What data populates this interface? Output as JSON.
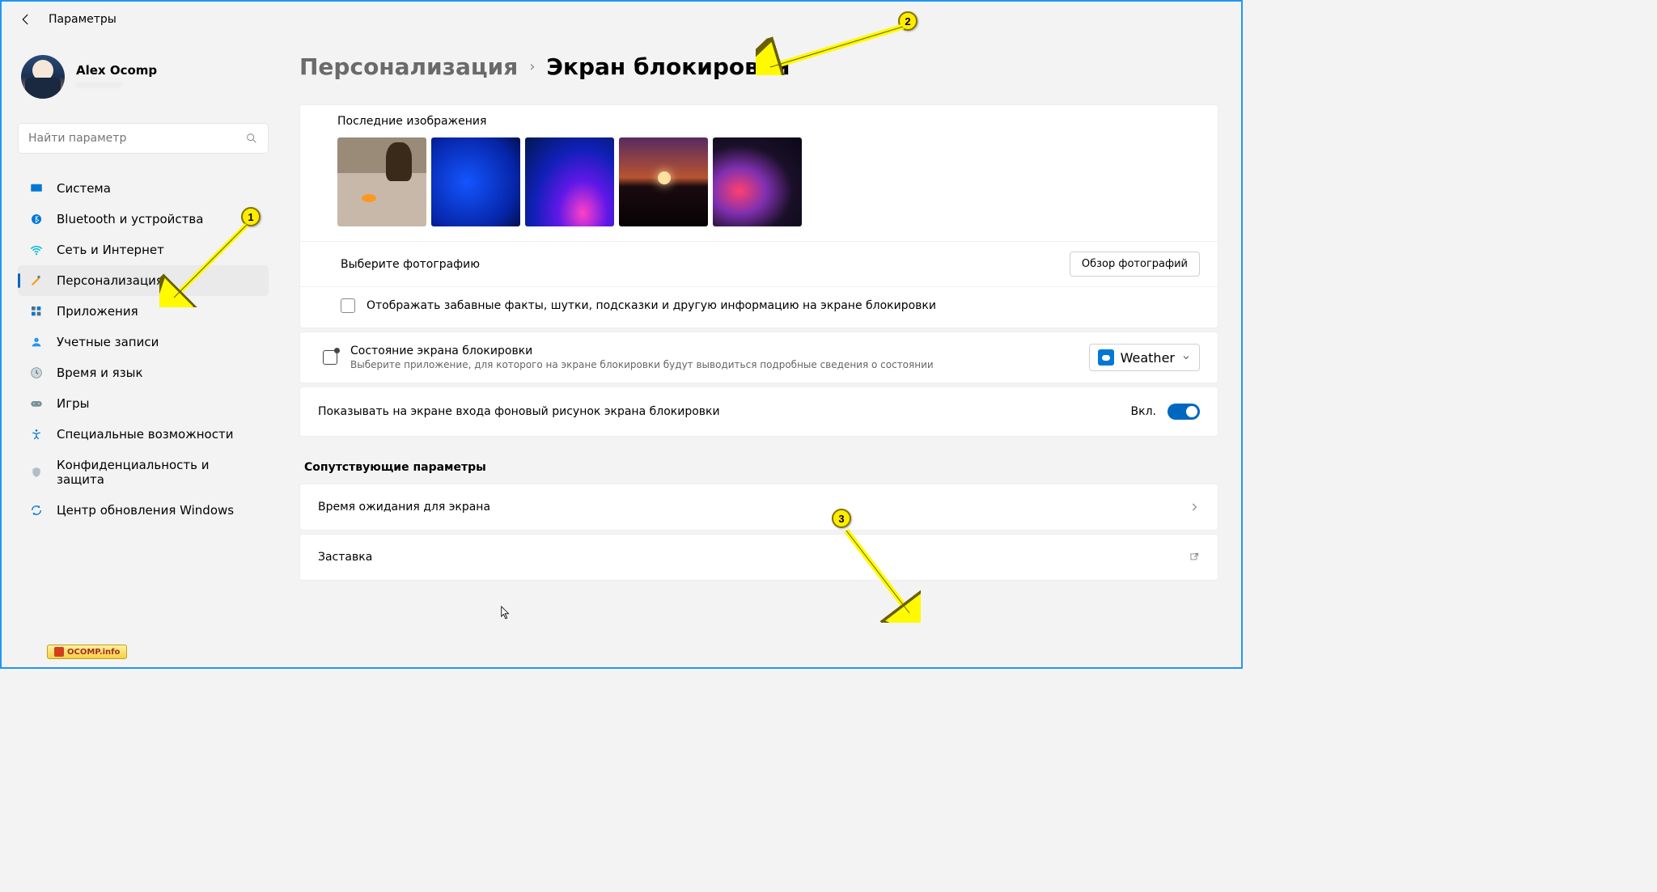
{
  "window": {
    "title": "Параметры"
  },
  "user": {
    "name": "Alex Ocomp",
    "email_placeholder": "············"
  },
  "search": {
    "placeholder": "Найти параметр"
  },
  "nav": {
    "items": [
      {
        "label": "Система"
      },
      {
        "label": "Bluetooth и устройства"
      },
      {
        "label": "Сеть и Интернет"
      },
      {
        "label": "Персонализация"
      },
      {
        "label": "Приложения"
      },
      {
        "label": "Учетные записи"
      },
      {
        "label": "Время и язык"
      },
      {
        "label": "Игры"
      },
      {
        "label": "Специальные возможности"
      },
      {
        "label": "Конфиденциальность и защита"
      },
      {
        "label": "Центр обновления Windows"
      }
    ],
    "active_index": 3
  },
  "breadcrumb": {
    "parent": "Персонализация",
    "current": "Экран блокировки"
  },
  "recent": {
    "label": "Последние изображения",
    "count": 5
  },
  "choose_photo": {
    "label": "Выберите фотографию",
    "browse": "Обзор фотографий"
  },
  "facts_checkbox": {
    "label": "Отображать забавные факты, шутки, подсказки и другую информацию на экране блокировки",
    "checked": false
  },
  "status": {
    "title": "Состояние экрана блокировки",
    "desc": "Выберите приложение, для которого на экране блокировки будут выводиться подробные сведения о состоянии",
    "selected_app": "Weather"
  },
  "signin_bg": {
    "label": "Показывать на экране входа фоновый рисунок экрана блокировки",
    "state": "Вкл.",
    "on": true
  },
  "related": {
    "header": "Сопутствующие параметры",
    "items": [
      {
        "label": "Время ожидания для экрана"
      },
      {
        "label": "Заставка"
      }
    ]
  },
  "annotations": {
    "n1": "1",
    "n2": "2",
    "n3": "3"
  },
  "watermark": "OCOMP.info"
}
